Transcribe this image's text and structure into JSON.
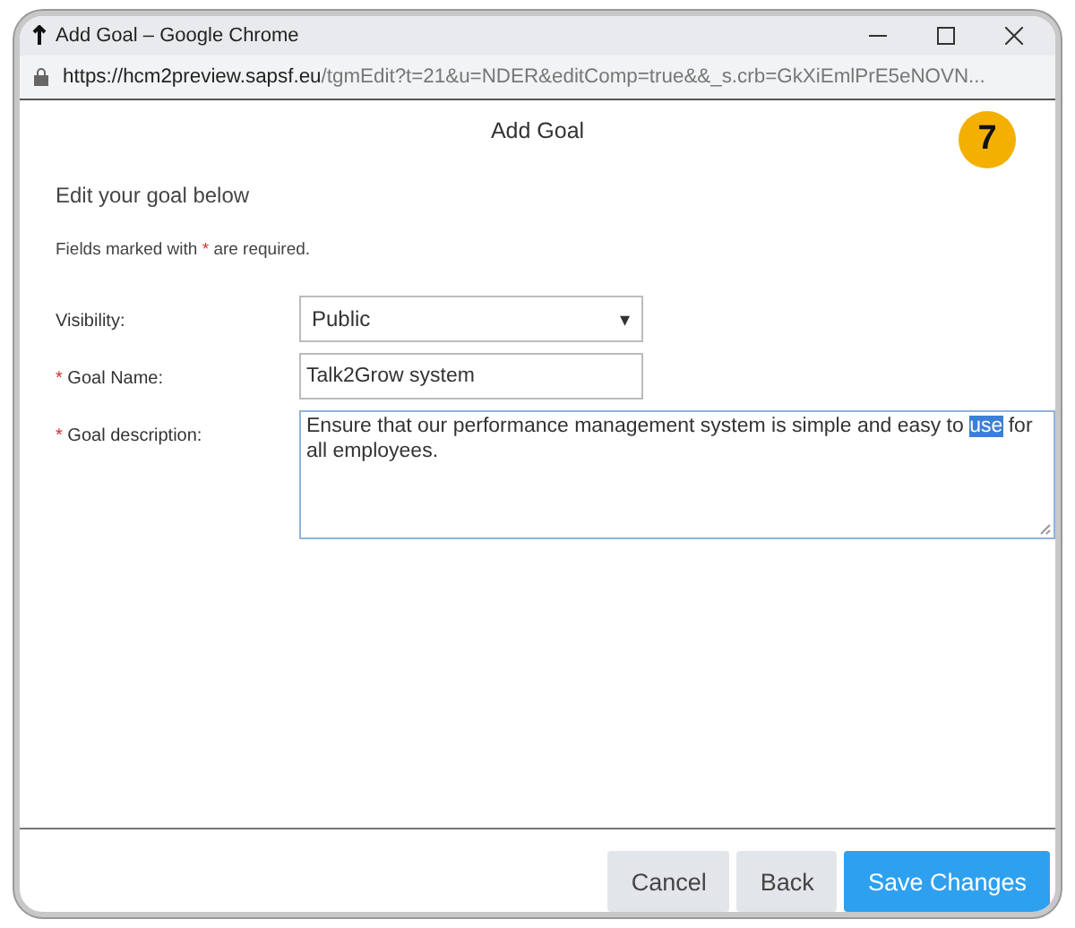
{
  "window": {
    "title": "Add Goal – Google Chrome"
  },
  "address_bar": {
    "host": "https://hcm2preview.sapsf.eu",
    "path": "/tgmEdit?t=21&u=NDER&editComp=true&&_s.crb=GkXiEmlPrE5eNOVN..."
  },
  "dialog": {
    "title": "Add Goal",
    "step_badge": "7",
    "intro": "Edit your goal below",
    "required_note_before": "Fields marked with",
    "required_mark": "*",
    "required_note_after": "are required."
  },
  "fields": [
    {
      "kind": "select",
      "label": "Visibility:",
      "required": false,
      "value": "Public",
      "arrow": "▾"
    },
    {
      "kind": "text",
      "label": "Goal Name:",
      "required": true,
      "value": "Talk2Grow system"
    },
    {
      "kind": "textarea",
      "label": "Goal description:",
      "required": true,
      "value_before": "Ensure that our performance management system is simple and easy to ",
      "value_selected": "use",
      "value_after": " for all employees."
    }
  ],
  "buttons": [
    {
      "label": "Cancel",
      "primary": false
    },
    {
      "label": "Back",
      "primary": false
    },
    {
      "label": "Save Changes",
      "primary": true
    }
  ]
}
